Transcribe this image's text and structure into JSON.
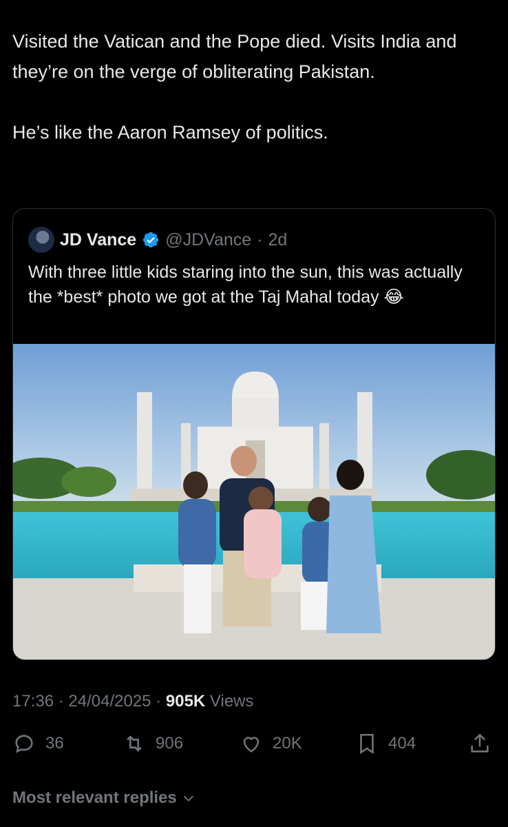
{
  "tweet": {
    "line1": "Visited the Vatican and the Pope died. Visits India and they’re on the verge of obliterating Pakistan.",
    "line2": "He’s like the Aaron Ramsey of politics."
  },
  "quote": {
    "name": "JD Vance",
    "handle": "@JDVance",
    "separator": "·",
    "time": "2d",
    "text": "With three little kids staring into the sun, this was actually the *best* photo we got at the Taj Mahal today 😂",
    "image_alt": "Family photo in front of the Taj Mahal"
  },
  "meta": {
    "time": "17:36",
    "separator": "·",
    "date": "24/04/2025",
    "views_count": "905K",
    "views_label": "Views"
  },
  "actions": {
    "replies": "36",
    "reposts": "906",
    "likes": "20K",
    "bookmarks": "404"
  },
  "replies_sort": {
    "label": "Most relevant replies"
  },
  "colors": {
    "background": "#000000",
    "text": "#e7e9ea",
    "muted": "#71767b",
    "verified": "#1d9bf0"
  }
}
